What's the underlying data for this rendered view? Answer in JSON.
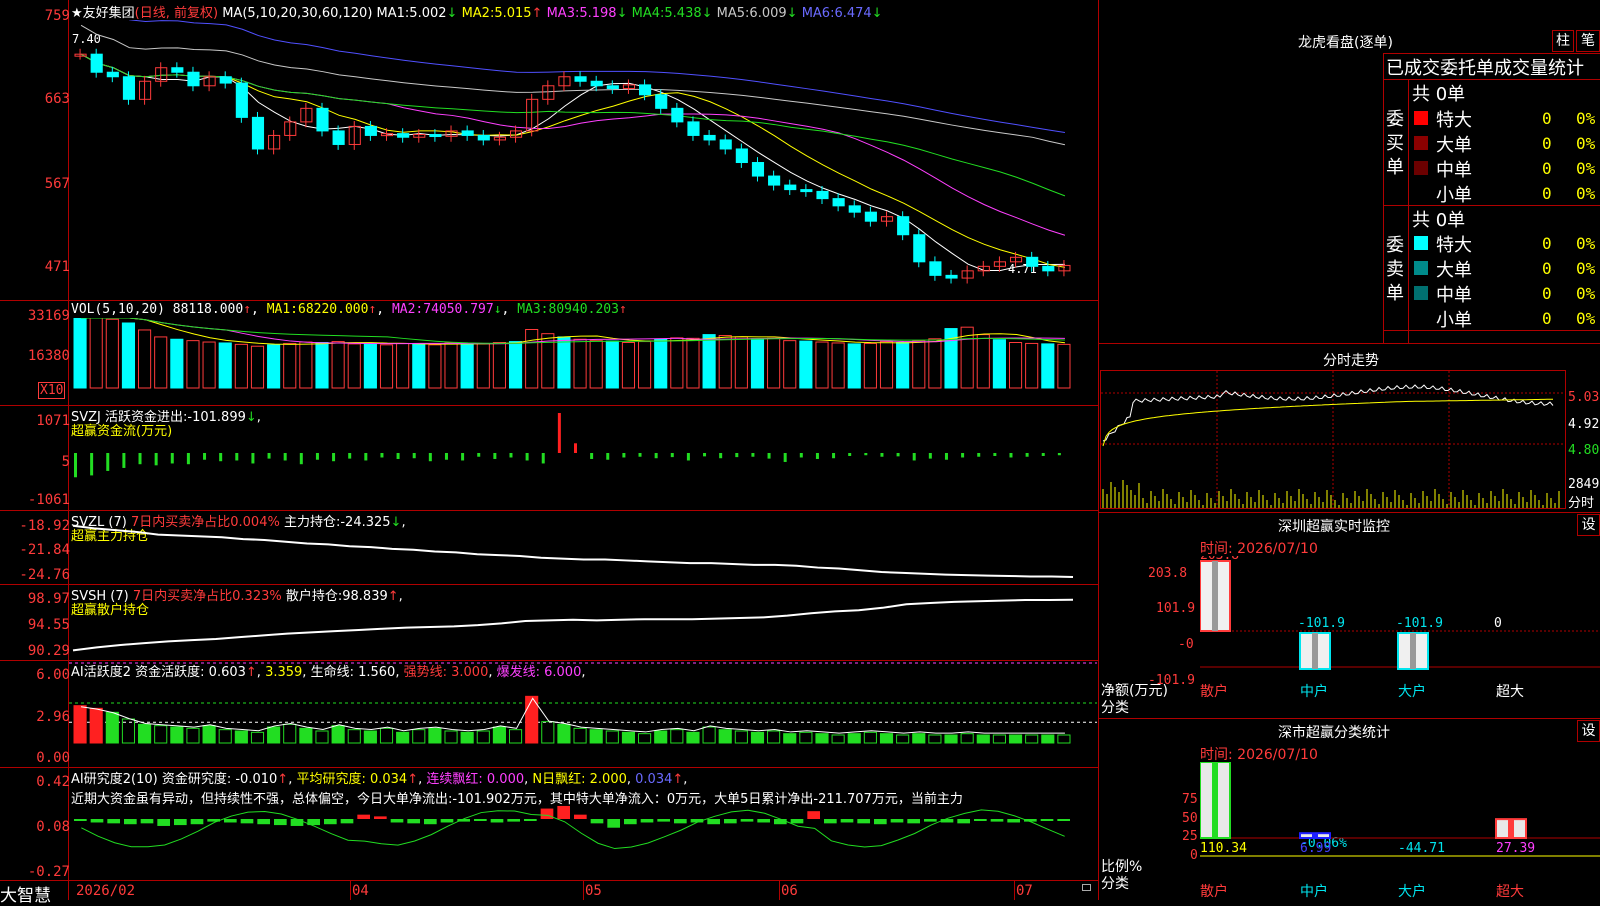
{
  "header": {
    "name": "★友好集团",
    "params": "(日线, 前复权)",
    "ma_set": "MA(5,10,20,30,60,120)",
    "ma1_label": "MA1:",
    "ma1": "5.002",
    "ma1_arrow": "↓",
    "ma2_label": "MA2:",
    "ma2": "5.015",
    "ma2_arrow": "↑",
    "ma3_label": "MA3:",
    "ma3": "5.198",
    "ma3_arrow": "↓",
    "ma4_label": "MA4:",
    "ma4": "5.438",
    "ma4_arrow": "↓",
    "ma5_label": "MA5:",
    "ma5": "6.009",
    "ma5_arrow": "↓",
    "ma6_label": "MA6:",
    "ma6": "6.474",
    "ma6_arrow": "↓"
  },
  "price_axis": [
    "759",
    "663",
    "567",
    "471"
  ],
  "price_high_mark": "7.40",
  "price_low_mark": "4.71",
  "vol": {
    "title": "VOL(5,10,20)",
    "value": "88118.000",
    "arrow": "↑",
    "ma1_label": "MA1:",
    "ma1": "68220.000",
    "ma1_arrow": "↑",
    "ma2_label": "MA2:",
    "ma2": "74050.797",
    "ma2_arrow": "↓",
    "ma3_label": "MA3:",
    "ma3": "80940.203",
    "ma3_arrow": "↑",
    "axis": [
      "33169",
      "16380"
    ],
    "unit": "X10"
  },
  "svzj": {
    "title": "SVZJ",
    "label": "活跃资金进出:",
    "value": "-101.899",
    "arrow": "↓",
    "suffix": ",",
    "sub": "超赢资金流(万元)",
    "axis": [
      "1071",
      "5",
      "-1061"
    ]
  },
  "svzl": {
    "title": "SVZL (7)",
    "ratio": "7日内买卖净占比0.004%",
    "label": "主力持仓:",
    "value": "-24.325",
    "arrow": "↓",
    "suffix": ",",
    "sub": "超赢主力持仓",
    "axis": [
      "-18.92",
      "-21.84",
      "-24.76"
    ]
  },
  "svsh": {
    "title": "SVSH (7)",
    "ratio": "7日内买卖净占比0.323%",
    "label": "散户持仓:",
    "value": "98.839",
    "arrow": "↑",
    "suffix": ",",
    "sub": "超赢散户持仓",
    "axis": [
      "98.97",
      "94.55",
      "90.29"
    ]
  },
  "ai1": {
    "title": "AI活跃度2",
    "label": "资金活跃度:",
    "value": "0.603",
    "arrow": "↑",
    "comma1": ",",
    "v2": "3.359",
    "comma2": ",",
    "life_label": "生命线:",
    "life": "1.560",
    "comma3": ",",
    "strong": "强势线: 3.000",
    "comma4": ",",
    "burst": "爆发线: 6.000",
    "comma5": ",",
    "axis": [
      "6.00",
      "2.96",
      "0.00"
    ]
  },
  "ai2": {
    "title": "AI研究度2(10)",
    "label": "资金研究度:",
    "value": "-0.010",
    "arrow": "↑",
    "comma1": ",",
    "avg": "平均研究度: 0.034",
    "avg_arrow": "↑",
    "comma2": ",",
    "red": "连续飘红: 0.000",
    "comma3": ",",
    "n": "N日飘红: 2.000",
    "comma4": ",",
    "n2": "0.034",
    "n2_arrow": "↑",
    "comma5": ",",
    "note": "近期大资金虽有异动，但持续性不强，总体偏空，今日大单净流出:-101.902万元，其中特大单净流入：0万元，大单5日累计净出-211.707万元，当前主力",
    "axis": [
      "0.42",
      "0.08",
      "-0.27"
    ]
  },
  "dates": [
    "2026/02",
    "04",
    "05",
    "06",
    "07"
  ],
  "logo": "大智慧",
  "right": {
    "title": "龙虎看盘(逐单)",
    "btn1": "柱",
    "btn2": "笔",
    "stat_title": "已成交委托单成交量统计",
    "buy_label": "委买单",
    "sell_label": "委卖单",
    "buy_total": "共 0单",
    "sell_total": "共 0单",
    "buy_rows": [
      {
        "label": "特大",
        "count": "0",
        "pct": "0%",
        "color": "#ff0000"
      },
      {
        "label": "大单",
        "count": "0",
        "pct": "0%",
        "color": "#8b0000"
      },
      {
        "label": "中单",
        "count": "0",
        "pct": "0%",
        "color": "#6b0000"
      },
      {
        "label": "小单",
        "count": "0",
        "pct": "0%",
        "color": "#000000"
      }
    ],
    "sell_rows": [
      {
        "label": "特大",
        "count": "0",
        "pct": "0%",
        "color": "#00ffff"
      },
      {
        "label": "大单",
        "count": "0",
        "pct": "0%",
        "color": "#008b8b"
      },
      {
        "label": "中单",
        "count": "0",
        "pct": "0%",
        "color": "#007070"
      },
      {
        "label": "小单",
        "count": "0",
        "pct": "0%",
        "color": "#000000"
      }
    ],
    "tick_title": "分时走势",
    "tick_axis": [
      "5.035",
      "4.920",
      "4.805"
    ],
    "tick_vol": "2849",
    "tick_vol_unit": "分时",
    "sz_title": "深圳超赢实时监控",
    "sz_btn": "设",
    "sz_time": "时间: 2026/07/10",
    "sz_axis": [
      "203.8",
      "101.9",
      "-0",
      "-101.9"
    ],
    "sz_unit": "净额(万元)",
    "sz_cat_label": "分类",
    "sz_vals": [
      "203.8",
      "-101.9",
      "-101.9",
      "0"
    ],
    "sz_cats": [
      "散户",
      "中户",
      "大户",
      "超大"
    ],
    "cls_title": "深市超赢分类统计",
    "cls_btn": "设",
    "cls_time": "时间: 2026/07/10",
    "cls_axis": [
      "75",
      "50",
      "25",
      "0"
    ],
    "cls_unit": "比例%",
    "cls_cat_label": "分类",
    "cls_small": "-0.06%",
    "cls_vals": [
      "110.34",
      "6.99",
      "-44.71",
      "27.39"
    ],
    "cls_cats": [
      "散户",
      "中户",
      "大户",
      "超大"
    ]
  },
  "chart_data": [
    {
      "type": "candlestick",
      "title": "友好集团 日线",
      "ylim": [
        4.71,
        7.59
      ],
      "series": [
        {
          "name": "K",
          "values": [
            7.3,
            7.1,
            7.05,
            6.8,
            7.0,
            7.15,
            7.1,
            6.95,
            7.05,
            6.98,
            6.6,
            6.25,
            6.4,
            6.55,
            6.7,
            6.45,
            6.3,
            6.5,
            6.4,
            6.42,
            6.38,
            6.41,
            6.39,
            6.45,
            6.4,
            6.35,
            6.38,
            6.45,
            6.8,
            6.95,
            7.05,
            7.0,
            6.95,
            6.92,
            6.96,
            6.85,
            6.7,
            6.55,
            6.4,
            6.35,
            6.25,
            6.1,
            5.95,
            5.85,
            5.8,
            5.78,
            5.7,
            5.62,
            5.55,
            5.45,
            5.5,
            5.3,
            5.0,
            4.85,
            4.82,
            4.9,
            4.95,
            5.0,
            5.05,
            4.95,
            4.9,
            4.96
          ]
        }
      ]
    },
    {
      "type": "bar",
      "title": "VOL",
      "ylim": [
        0,
        33169
      ],
      "series": [
        {
          "name": "VOL",
          "values": [
            16400,
            15800,
            14800,
            14000,
            12500,
            11000,
            10500,
            10200,
            9900,
            9700,
            9400,
            9000,
            9300,
            9600,
            9900,
            9800,
            10000,
            9500,
            9700,
            9300,
            9600,
            9400,
            9300,
            9700,
            9500,
            9600,
            9800,
            10000,
            12600,
            11700,
            11000,
            10500,
            10200,
            10100,
            9800,
            10000,
            10500,
            10800,
            10700,
            11500,
            11300,
            11000,
            10600,
            10700,
            10200,
            10100,
            9900,
            9700,
            9500,
            9600,
            10000,
            9800,
            10200,
            10600,
            12800,
            13100,
            11500,
            10400,
            9800,
            9600,
            9500,
            9400
          ]
        }
      ]
    },
    {
      "type": "bar",
      "title": "SVZJ",
      "ylim": [
        -1061,
        1071
      ],
      "series": [
        {
          "name": "SVZJ",
          "values": [
            -650,
            -600,
            -480,
            -400,
            -300,
            -330,
            -280,
            -300,
            -180,
            -220,
            -200,
            -280,
            -150,
            -200,
            -300,
            -180,
            -220,
            -150,
            -200,
            -120,
            -160,
            -140,
            -220,
            -180,
            -200,
            -100,
            -160,
            -120,
            -200,
            -280,
            1071,
            260,
            -160,
            -180,
            -120,
            -100,
            -140,
            -110,
            -200,
            -90,
            -140,
            -110,
            -100,
            -150,
            -240,
            -120,
            -160,
            -140,
            -80,
            -60,
            -100,
            -90,
            -200,
            -150,
            -180,
            -120,
            -100,
            -80,
            -120,
            -100,
            -80,
            -60
          ]
        }
      ]
    },
    {
      "type": "line",
      "title": "SVZL",
      "ylim": [
        -24.76,
        -18.92
      ],
      "series": [
        {
          "name": "主力持仓",
          "values": [
            -19.0,
            -19.3,
            -19.5,
            -19.7,
            -20.0,
            -20.1,
            -20.2,
            -20.3,
            -20.5,
            -20.6,
            -20.8,
            -21.0,
            -21.1,
            -21.3,
            -21.4,
            -21.6,
            -21.7,
            -21.9,
            -22.0,
            -22.2,
            -22.3,
            -22.4,
            -22.6,
            -22.7,
            -22.8,
            -22.8,
            -22.9,
            -23.0,
            -23.1,
            -23.2,
            -23.2,
            -23.3,
            -23.4,
            -23.4,
            -23.5,
            -23.7,
            -23.8,
            -24.0,
            -24.2,
            -24.3,
            -24.4,
            -24.5,
            -24.55,
            -24.6,
            -24.65,
            -24.7,
            -24.7,
            -24.76
          ]
        }
      ]
    },
    {
      "type": "line",
      "title": "SVSH",
      "ylim": [
        90.29,
        98.97
      ],
      "series": [
        {
          "name": "散户持仓",
          "values": [
            90.4,
            90.9,
            91.3,
            91.6,
            91.9,
            92.1,
            92.3,
            92.6,
            92.9,
            93.2,
            93.4,
            93.6,
            93.8,
            94.0,
            94.2,
            94.3,
            94.4,
            94.6,
            94.9,
            95.3,
            95.4,
            95.5,
            95.4,
            95.5,
            95.6,
            95.6,
            95.6,
            95.7,
            95.8,
            95.9,
            96.2,
            96.6,
            96.9,
            97.1,
            97.5,
            98.1,
            98.3,
            98.5,
            98.6,
            98.7,
            98.8,
            98.8,
            98.84
          ]
        }
      ]
    },
    {
      "type": "bar",
      "title": "AI活跃度2",
      "ylim": [
        0,
        6.0
      ],
      "series": [
        {
          "name": "资金活跃度",
          "values": [
            2.8,
            2.6,
            2.3,
            1.8,
            1.4,
            1.3,
            1.2,
            1.1,
            1.3,
            1.0,
            0.9,
            0.8,
            1.2,
            1.4,
            1.1,
            0.9,
            1.3,
            1.0,
            0.9,
            1.1,
            0.8,
            1.0,
            1.1,
            0.9,
            0.8,
            0.9,
            1.2,
            1.0,
            3.5,
            1.6,
            1.4,
            1.1,
            1.0,
            0.9,
            0.8,
            0.7,
            0.9,
            1.0,
            0.8,
            1.2,
            1.0,
            0.9,
            0.8,
            0.9,
            0.7,
            0.8,
            0.7,
            0.6,
            0.7,
            0.8,
            0.7,
            0.6,
            0.7,
            0.6,
            0.6,
            0.7,
            0.6,
            0.6,
            0.6,
            0.6,
            0.6,
            0.6
          ]
        }
      ]
    },
    {
      "type": "bar",
      "title": "AI研究度2",
      "ylim": [
        -0.27,
        0.42
      ],
      "series": [
        {
          "name": "资金研究度",
          "values": [
            -0.02,
            -0.04,
            -0.05,
            -0.06,
            -0.05,
            -0.08,
            -0.07,
            -0.06,
            -0.03,
            -0.04,
            -0.05,
            -0.06,
            -0.07,
            -0.08,
            -0.07,
            -0.06,
            -0.05,
            0.05,
            0.03,
            -0.04,
            -0.05,
            -0.06,
            -0.04,
            -0.03,
            -0.02,
            -0.04,
            -0.03,
            -0.02,
            0.12,
            0.15,
            0.05,
            -0.05,
            -0.1,
            -0.06,
            -0.04,
            -0.03,
            -0.05,
            -0.04,
            -0.06,
            -0.05,
            -0.03,
            -0.04,
            -0.06,
            -0.05,
            0.09,
            -0.05,
            -0.04,
            -0.05,
            -0.06,
            -0.04,
            -0.05,
            -0.03,
            -0.04,
            -0.05,
            -0.02,
            -0.03,
            -0.04,
            -0.03,
            -0.02,
            -0.01
          ]
        }
      ]
    }
  ]
}
